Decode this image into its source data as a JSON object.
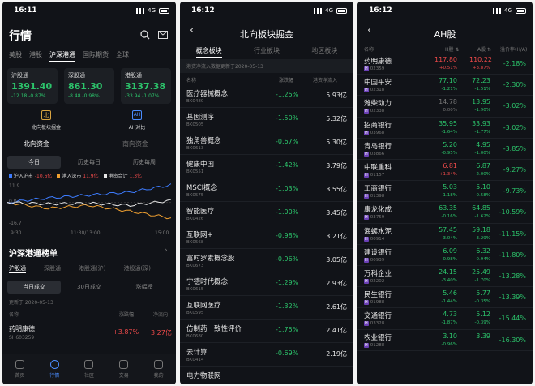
{
  "p1": {
    "time": "16:11",
    "network": "4G",
    "title": "行情",
    "tabs": [
      "美股",
      "港股",
      "沪深港通",
      "国际期货",
      "全球"
    ],
    "indices": [
      {
        "name": "沪股通",
        "value": "1391.40",
        "change": "-12.18 -0.87%"
      },
      {
        "name": "深股通",
        "value": "861.30",
        "change": "-8.48 -0.98%"
      },
      {
        "name": "港股通",
        "value": "3137.38",
        "change": "-33.94 -1.07%"
      }
    ],
    "north_fund": "北向板块掘金",
    "ah_compare": "AH对比",
    "fund_tabs": [
      "北向资金",
      "南向资金"
    ],
    "period_tabs": [
      "今日",
      "历史每日",
      "历史每周"
    ],
    "legend": [
      {
        "label": "沪入沪市",
        "value": "-10.6亿",
        "color": "#f0a030"
      },
      {
        "label": "港入深市",
        "value": "11.9亿",
        "color": "#f04a4a"
      },
      {
        "label": "港资合计",
        "value": "1.3亿",
        "color": "#f07030"
      }
    ],
    "y_top": "11.9",
    "y_zero": "0.0",
    "y_bottom": "-16.7",
    "x_labels": [
      "9:30",
      "11:30/13:00",
      "15:00"
    ],
    "chart_data": {
      "type": "line",
      "x": [
        "9:30",
        "11:30/13:00",
        "15:00"
      ],
      "ylim": [
        -16.7,
        11.9
      ],
      "series": [
        {
          "name": "沪入沪市",
          "color": "#f0a030",
          "values": [
            0,
            -4,
            -2,
            -6,
            -10.6
          ]
        },
        {
          "name": "港入深市",
          "color": "#3d7cff",
          "values": [
            0,
            3,
            5,
            7,
            11.9
          ]
        },
        {
          "name": "港资合计",
          "color": "#e8e8e8",
          "values": [
            0,
            -1,
            -0.5,
            -2,
            1.3
          ]
        }
      ]
    },
    "rank_title": "沪深港通榜单",
    "rank_tabs": [
      "沪股通",
      "深股通",
      "港股通(沪)",
      "港股通(深)"
    ],
    "rank_period": [
      "当日成交",
      "30日成交",
      "涨幅榜"
    ],
    "update": "更新于 2020-05-13",
    "cols": [
      "名称",
      "涨跌幅",
      "净流向"
    ],
    "rows": [
      {
        "name": "药明康德",
        "code": "SH603259",
        "pct": "+3.87%",
        "flow": "3.27亿"
      }
    ],
    "nav": [
      "首页",
      "行情",
      "社区",
      "交易",
      "我的"
    ]
  },
  "p2": {
    "time": "16:12",
    "network": "4G",
    "title": "北向板块掘金",
    "tabs": [
      "概念板块",
      "行业板块",
      "地区板块"
    ],
    "note": "港资净流入数据更新于2020-05-13",
    "cols": [
      "名称",
      "涨跌幅",
      "港资净流入"
    ],
    "rows": [
      {
        "name": "医疗器械概念",
        "code": "BK0480",
        "pct": "-1.25%",
        "flow": "5.93亿"
      },
      {
        "name": "基因测序",
        "code": "BK0505",
        "pct": "-1.50%",
        "flow": "5.32亿"
      },
      {
        "name": "独角兽概念",
        "code": "BK0613",
        "pct": "-0.67%",
        "flow": "5.30亿"
      },
      {
        "name": "健康中国",
        "code": "BK0551",
        "pct": "-1.42%",
        "flow": "3.79亿"
      },
      {
        "name": "MSCI概念",
        "code": "BK0575",
        "pct": "-1.03%",
        "flow": "3.55亿"
      },
      {
        "name": "智能医疗",
        "code": "BK0426",
        "pct": "-1.00%",
        "flow": "3.45亿"
      },
      {
        "name": "互联网+",
        "code": "BK0568",
        "pct": "-0.98%",
        "flow": "3.21亿"
      },
      {
        "name": "富时罗素概念股",
        "code": "BK0673",
        "pct": "-0.96%",
        "flow": "3.05亿"
      },
      {
        "name": "宁德时代概念",
        "code": "BK0615",
        "pct": "-1.29%",
        "flow": "2.93亿"
      },
      {
        "name": "互联网医疗",
        "code": "BK0595",
        "pct": "-1.32%",
        "flow": "2.61亿"
      },
      {
        "name": "仿制药一致性评价",
        "code": "BK0680",
        "pct": "-1.75%",
        "flow": "2.41亿"
      },
      {
        "name": "云计算",
        "code": "BK0414",
        "pct": "-0.69%",
        "flow": "2.19亿"
      },
      {
        "name": "电力物联网",
        "code": "",
        "pct": "",
        "flow": ""
      }
    ]
  },
  "p3": {
    "time": "16:12",
    "network": "4G",
    "title": "AH股",
    "cols": [
      "名称",
      "H股",
      "A股",
      "溢价率(H/A)"
    ],
    "rows": [
      {
        "name": "药明康德",
        "code": "02359",
        "h": "117.80",
        "hc": "+0.51%",
        "a": "110.22",
        "ac": "+3.87%",
        "p": "-2.18%",
        "hred": true,
        "ared": true
      },
      {
        "name": "中国平安",
        "code": "02318",
        "h": "77.10",
        "hc": "-1.21%",
        "a": "72.23",
        "ac": "-1.51%",
        "p": "-2.30%"
      },
      {
        "name": "潍柴动力",
        "code": "02338",
        "h": "14.78",
        "hc": "0.00%",
        "a": "13.95",
        "ac": "-1.90%",
        "p": "-3.02%",
        "hmuted": true
      },
      {
        "name": "招商银行",
        "code": "03968",
        "h": "35.95",
        "hc": "-1.64%",
        "a": "33.93",
        "ac": "-1.77%",
        "p": "-3.02%"
      },
      {
        "name": "青岛银行",
        "code": "03866",
        "h": "5.20",
        "hc": "-0.95%",
        "a": "4.95",
        "ac": "-1.00%",
        "p": "-3.85%"
      },
      {
        "name": "中联重科",
        "code": "01157",
        "h": "6.81",
        "hc": "+1.34%",
        "a": "6.87",
        "ac": "-2.00%",
        "p": "-9.27%",
        "hred": true
      },
      {
        "name": "工商银行",
        "code": "01398",
        "h": "5.03",
        "hc": "-1.18%",
        "a": "5.10",
        "ac": "-0.58%",
        "p": "-9.73%"
      },
      {
        "name": "康龙化成",
        "code": "03759",
        "h": "63.35",
        "hc": "-0.16%",
        "a": "64.85",
        "ac": "-1.62%",
        "p": "-10.59%"
      },
      {
        "name": "海螺水泥",
        "code": "00914",
        "h": "57.45",
        "hc": "-3.04%",
        "a": "59.18",
        "ac": "-3.29%",
        "p": "-11.15%"
      },
      {
        "name": "建设银行",
        "code": "00939",
        "h": "6.09",
        "hc": "-0.98%",
        "a": "6.32",
        "ac": "-0.94%",
        "p": "-11.80%"
      },
      {
        "name": "万科企业",
        "code": "02202",
        "h": "24.15",
        "hc": "-3.40%",
        "a": "25.49",
        "ac": "-1.70%",
        "p": "-13.28%"
      },
      {
        "name": "民生银行",
        "code": "01988",
        "h": "5.46",
        "hc": "-1.44%",
        "a": "5.77",
        "ac": "-0.35%",
        "p": "-13.39%"
      },
      {
        "name": "交通银行",
        "code": "03328",
        "h": "4.73",
        "hc": "-1.87%",
        "a": "5.12",
        "ac": "-0.39%",
        "p": "-15.44%"
      },
      {
        "name": "农业银行",
        "code": "01288",
        "h": "3.10",
        "hc": "-0.96%",
        "a": "3.39",
        "ac": "",
        "p": "-16.30%"
      }
    ]
  }
}
